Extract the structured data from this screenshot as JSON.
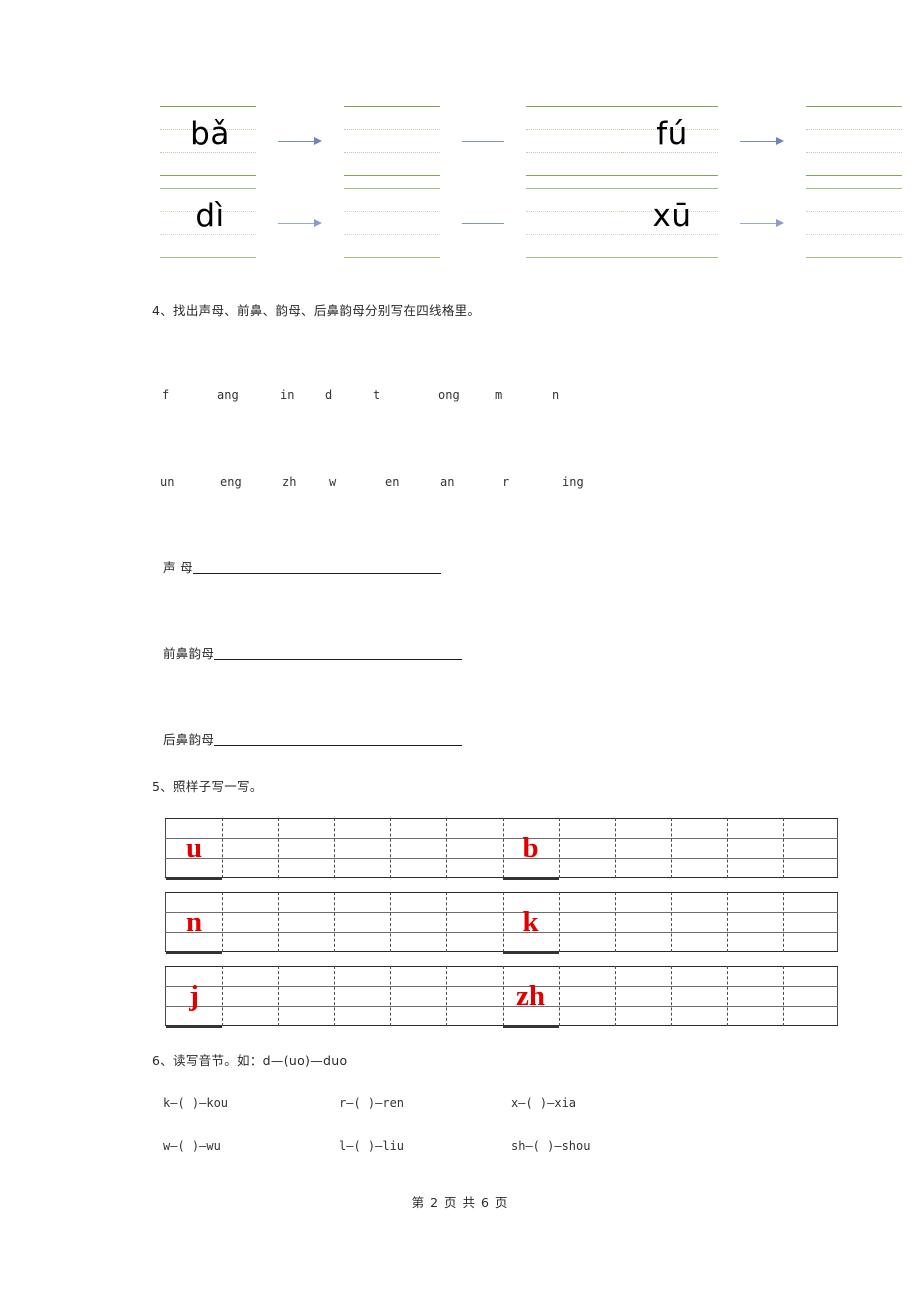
{
  "section_pinyin": {
    "rows": [
      {
        "left": {
          "syllable": "bǎ",
          "arrow": "arrow-right",
          "blanks": 2
        },
        "right": {
          "syllable": "fú",
          "arrow": "arrow-right",
          "blanks": 2
        }
      },
      {
        "left": {
          "syllable": "dì",
          "arrow": "arrow-right",
          "blanks": 2
        },
        "right": {
          "syllable": "xū",
          "arrow": "arrow-right",
          "blanks": 2
        }
      }
    ]
  },
  "q4": {
    "heading": "4、找出声母、前鼻、韵母、后鼻韵母分别写在四线格里。",
    "letters_row1": [
      "f",
      "ang",
      "in",
      "d",
      "t",
      "ong",
      "m",
      "n"
    ],
    "letters_row2": [
      "un",
      "eng",
      "zh",
      "w",
      "en",
      "an",
      "r",
      "ing"
    ],
    "answer_labels": [
      "声  母",
      "前鼻韵母",
      "后鼻韵母"
    ]
  },
  "q5": {
    "heading": "5、照样子写一写。",
    "rows": [
      {
        "left_letter": "u",
        "right_letter": "b"
      },
      {
        "left_letter": "n",
        "right_letter": "k"
      },
      {
        "left_letter": "j",
        "right_letter": "zh"
      }
    ],
    "cells_per_row": 12,
    "letter_color": "#e00000"
  },
  "q6": {
    "heading": "6、读写音节。如：d—(uo)—duo",
    "line1": [
      "k—(  )—kou",
      "r—(  )—ren",
      "x—(  )—xia"
    ],
    "line2": [
      "w—(  )—wu",
      "l—(  )—liu",
      "sh—(  )—shou"
    ]
  },
  "footer": {
    "text": "第 2 页 共 6 页"
  }
}
